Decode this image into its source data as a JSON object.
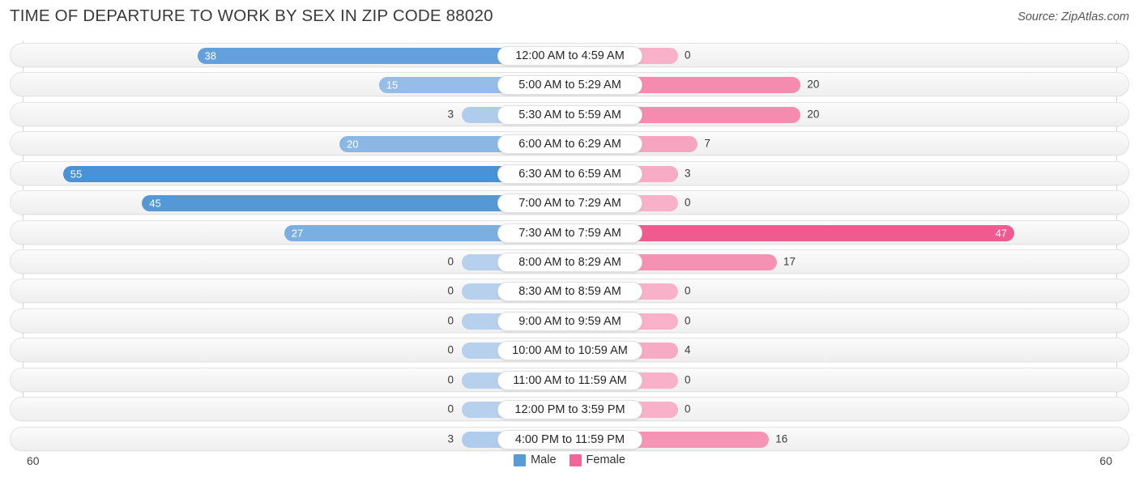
{
  "title": "TIME OF DEPARTURE TO WORK BY SEX IN ZIP CODE 88020",
  "source": "Source: ZipAtlas.com",
  "legend": {
    "male": {
      "label": "Male",
      "color": "#5B9BD5"
    },
    "female": {
      "label": "Female",
      "color": "#F2659A"
    }
  },
  "axis": {
    "left_max": "60",
    "right_max": "60"
  },
  "chart_data": {
    "type": "bar",
    "orientation": "horizontal-diverging",
    "title": "TIME OF DEPARTURE TO WORK BY SEX IN ZIP CODE 88020",
    "xlabel": "",
    "ylabel": "",
    "xlim": [
      60,
      60
    ],
    "grid": true,
    "legend_position": "bottom-center",
    "categories": [
      "12:00 AM to 4:59 AM",
      "5:00 AM to 5:29 AM",
      "5:30 AM to 5:59 AM",
      "6:00 AM to 6:29 AM",
      "6:30 AM to 6:59 AM",
      "7:00 AM to 7:29 AM",
      "7:30 AM to 7:59 AM",
      "8:00 AM to 8:29 AM",
      "8:30 AM to 8:59 AM",
      "9:00 AM to 9:59 AM",
      "10:00 AM to 10:59 AM",
      "11:00 AM to 11:59 AM",
      "12:00 PM to 3:59 PM",
      "4:00 PM to 11:59 PM"
    ],
    "series": [
      {
        "name": "Male",
        "color": "#5B9BD5",
        "values": [
          38,
          15,
          3,
          20,
          55,
          45,
          27,
          0,
          0,
          0,
          0,
          0,
          0,
          3
        ]
      },
      {
        "name": "Female",
        "color": "#F2659A",
        "values": [
          0,
          20,
          20,
          7,
          3,
          0,
          47,
          17,
          0,
          0,
          4,
          0,
          0,
          16
        ]
      }
    ]
  }
}
